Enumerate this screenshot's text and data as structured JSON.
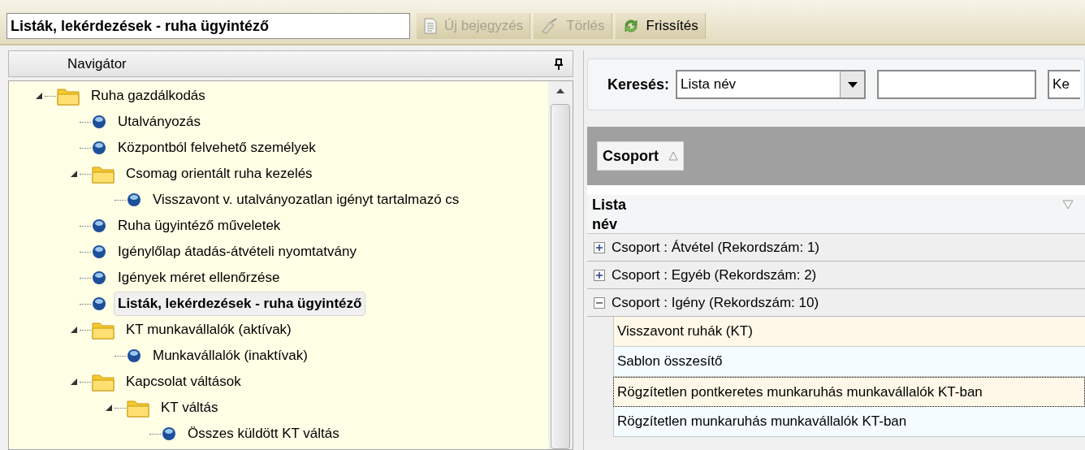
{
  "toolbar": {
    "title_field": {
      "value": "Listák, lekérdezések - ruha ügyintéző"
    },
    "buttons": [
      {
        "label": "Új bejegyzés",
        "kind": "new",
        "disabled": true
      },
      {
        "label": "Törlés",
        "kind": "delete",
        "disabled": true
      },
      {
        "label": "Frissítés",
        "kind": "refresh",
        "disabled": false
      }
    ]
  },
  "navigator": {
    "title": "Navigátor",
    "tree": [
      {
        "label": "Ruha gazdálkodás",
        "kind": "folder",
        "expanded": true,
        "selected": false,
        "children": [
          {
            "label": "Utalványozás",
            "kind": "item",
            "selected": false
          },
          {
            "label": "Központból felvehető személyek",
            "kind": "item",
            "selected": false
          },
          {
            "label": "Csomag orientált ruha kezelés",
            "kind": "folder",
            "expanded": true,
            "selected": false,
            "children": [
              {
                "label": "Visszavont v. utalványozatlan igényt tartalmazó cs",
                "kind": "item",
                "selected": false
              }
            ]
          },
          {
            "label": "Ruha ügyintéző műveletek",
            "kind": "item",
            "selected": false
          },
          {
            "label": "Igénylőlap átadás-átvételi nyomtatvány",
            "kind": "item",
            "selected": false
          },
          {
            "label": "Igények méret ellenőrzése",
            "kind": "item",
            "selected": false
          },
          {
            "label": "Listák, lekérdezések - ruha ügyintéző",
            "kind": "item",
            "selected": true
          },
          {
            "label": "KT munkavállalók (aktívak)",
            "kind": "folder",
            "expanded": true,
            "selected": false,
            "children": [
              {
                "label": "Munkavállalók (inaktívak)",
                "kind": "item",
                "selected": false
              }
            ]
          },
          {
            "label": "Kapcsolat váltások",
            "kind": "folder",
            "expanded": true,
            "selected": false,
            "children": [
              {
                "label": "KT váltás",
                "kind": "folder",
                "expanded": true,
                "selected": false,
                "children": [
                  {
                    "label": "Összes küldött KT váltás",
                    "kind": "item",
                    "selected": false
                  }
                ]
              }
            ]
          }
        ]
      }
    ]
  },
  "search": {
    "label": "Keresés:",
    "field_select": {
      "value": "Lista név"
    },
    "cut_field": {
      "value": "Ke"
    }
  },
  "grid": {
    "group_by": {
      "label": "Csoport"
    },
    "columns": [
      {
        "label": "Lista\nnév"
      }
    ],
    "groups": [
      {
        "label": "Csoport : Átvétel (Rekordszám: 1)",
        "expanded": false
      },
      {
        "label": "Csoport : Egyéb (Rekordszám: 2)",
        "expanded": false
      },
      {
        "label": "Csoport : Igény (Rekordszám: 10)",
        "expanded": true,
        "rows": [
          {
            "name": "Visszavont ruhák (KT)",
            "focused": false
          },
          {
            "name": "Sablon összesítő",
            "focused": false
          },
          {
            "name": "Rögzítetlen pontkeretes munkaruhás munkavállalók KT-ban",
            "focused": true
          },
          {
            "name": "Rögzítetlen munkaruhás munkavállalók KT-ban",
            "focused": false
          }
        ]
      }
    ]
  }
}
